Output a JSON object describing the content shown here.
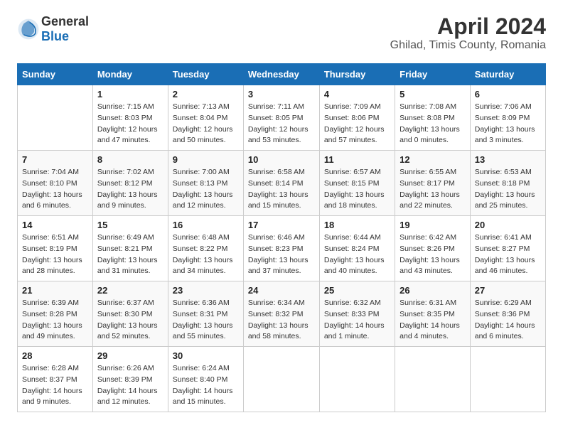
{
  "header": {
    "logo_general": "General",
    "logo_blue": "Blue",
    "month_title": "April 2024",
    "location": "Ghilad, Timis County, Romania"
  },
  "weekdays": [
    "Sunday",
    "Monday",
    "Tuesday",
    "Wednesday",
    "Thursday",
    "Friday",
    "Saturday"
  ],
  "weeks": [
    [
      {
        "day": "",
        "sunrise": "",
        "sunset": "",
        "daylight": ""
      },
      {
        "day": "1",
        "sunrise": "Sunrise: 7:15 AM",
        "sunset": "Sunset: 8:03 PM",
        "daylight": "Daylight: 12 hours and 47 minutes."
      },
      {
        "day": "2",
        "sunrise": "Sunrise: 7:13 AM",
        "sunset": "Sunset: 8:04 PM",
        "daylight": "Daylight: 12 hours and 50 minutes."
      },
      {
        "day": "3",
        "sunrise": "Sunrise: 7:11 AM",
        "sunset": "Sunset: 8:05 PM",
        "daylight": "Daylight: 12 hours and 53 minutes."
      },
      {
        "day": "4",
        "sunrise": "Sunrise: 7:09 AM",
        "sunset": "Sunset: 8:06 PM",
        "daylight": "Daylight: 12 hours and 57 minutes."
      },
      {
        "day": "5",
        "sunrise": "Sunrise: 7:08 AM",
        "sunset": "Sunset: 8:08 PM",
        "daylight": "Daylight: 13 hours and 0 minutes."
      },
      {
        "day": "6",
        "sunrise": "Sunrise: 7:06 AM",
        "sunset": "Sunset: 8:09 PM",
        "daylight": "Daylight: 13 hours and 3 minutes."
      }
    ],
    [
      {
        "day": "7",
        "sunrise": "Sunrise: 7:04 AM",
        "sunset": "Sunset: 8:10 PM",
        "daylight": "Daylight: 13 hours and 6 minutes."
      },
      {
        "day": "8",
        "sunrise": "Sunrise: 7:02 AM",
        "sunset": "Sunset: 8:12 PM",
        "daylight": "Daylight: 13 hours and 9 minutes."
      },
      {
        "day": "9",
        "sunrise": "Sunrise: 7:00 AM",
        "sunset": "Sunset: 8:13 PM",
        "daylight": "Daylight: 13 hours and 12 minutes."
      },
      {
        "day": "10",
        "sunrise": "Sunrise: 6:58 AM",
        "sunset": "Sunset: 8:14 PM",
        "daylight": "Daylight: 13 hours and 15 minutes."
      },
      {
        "day": "11",
        "sunrise": "Sunrise: 6:57 AM",
        "sunset": "Sunset: 8:15 PM",
        "daylight": "Daylight: 13 hours and 18 minutes."
      },
      {
        "day": "12",
        "sunrise": "Sunrise: 6:55 AM",
        "sunset": "Sunset: 8:17 PM",
        "daylight": "Daylight: 13 hours and 22 minutes."
      },
      {
        "day": "13",
        "sunrise": "Sunrise: 6:53 AM",
        "sunset": "Sunset: 8:18 PM",
        "daylight": "Daylight: 13 hours and 25 minutes."
      }
    ],
    [
      {
        "day": "14",
        "sunrise": "Sunrise: 6:51 AM",
        "sunset": "Sunset: 8:19 PM",
        "daylight": "Daylight: 13 hours and 28 minutes."
      },
      {
        "day": "15",
        "sunrise": "Sunrise: 6:49 AM",
        "sunset": "Sunset: 8:21 PM",
        "daylight": "Daylight: 13 hours and 31 minutes."
      },
      {
        "day": "16",
        "sunrise": "Sunrise: 6:48 AM",
        "sunset": "Sunset: 8:22 PM",
        "daylight": "Daylight: 13 hours and 34 minutes."
      },
      {
        "day": "17",
        "sunrise": "Sunrise: 6:46 AM",
        "sunset": "Sunset: 8:23 PM",
        "daylight": "Daylight: 13 hours and 37 minutes."
      },
      {
        "day": "18",
        "sunrise": "Sunrise: 6:44 AM",
        "sunset": "Sunset: 8:24 PM",
        "daylight": "Daylight: 13 hours and 40 minutes."
      },
      {
        "day": "19",
        "sunrise": "Sunrise: 6:42 AM",
        "sunset": "Sunset: 8:26 PM",
        "daylight": "Daylight: 13 hours and 43 minutes."
      },
      {
        "day": "20",
        "sunrise": "Sunrise: 6:41 AM",
        "sunset": "Sunset: 8:27 PM",
        "daylight": "Daylight: 13 hours and 46 minutes."
      }
    ],
    [
      {
        "day": "21",
        "sunrise": "Sunrise: 6:39 AM",
        "sunset": "Sunset: 8:28 PM",
        "daylight": "Daylight: 13 hours and 49 minutes."
      },
      {
        "day": "22",
        "sunrise": "Sunrise: 6:37 AM",
        "sunset": "Sunset: 8:30 PM",
        "daylight": "Daylight: 13 hours and 52 minutes."
      },
      {
        "day": "23",
        "sunrise": "Sunrise: 6:36 AM",
        "sunset": "Sunset: 8:31 PM",
        "daylight": "Daylight: 13 hours and 55 minutes."
      },
      {
        "day": "24",
        "sunrise": "Sunrise: 6:34 AM",
        "sunset": "Sunset: 8:32 PM",
        "daylight": "Daylight: 13 hours and 58 minutes."
      },
      {
        "day": "25",
        "sunrise": "Sunrise: 6:32 AM",
        "sunset": "Sunset: 8:33 PM",
        "daylight": "Daylight: 14 hours and 1 minute."
      },
      {
        "day": "26",
        "sunrise": "Sunrise: 6:31 AM",
        "sunset": "Sunset: 8:35 PM",
        "daylight": "Daylight: 14 hours and 4 minutes."
      },
      {
        "day": "27",
        "sunrise": "Sunrise: 6:29 AM",
        "sunset": "Sunset: 8:36 PM",
        "daylight": "Daylight: 14 hours and 6 minutes."
      }
    ],
    [
      {
        "day": "28",
        "sunrise": "Sunrise: 6:28 AM",
        "sunset": "Sunset: 8:37 PM",
        "daylight": "Daylight: 14 hours and 9 minutes."
      },
      {
        "day": "29",
        "sunrise": "Sunrise: 6:26 AM",
        "sunset": "Sunset: 8:39 PM",
        "daylight": "Daylight: 14 hours and 12 minutes."
      },
      {
        "day": "30",
        "sunrise": "Sunrise: 6:24 AM",
        "sunset": "Sunset: 8:40 PM",
        "daylight": "Daylight: 14 hours and 15 minutes."
      },
      {
        "day": "",
        "sunrise": "",
        "sunset": "",
        "daylight": ""
      },
      {
        "day": "",
        "sunrise": "",
        "sunset": "",
        "daylight": ""
      },
      {
        "day": "",
        "sunrise": "",
        "sunset": "",
        "daylight": ""
      },
      {
        "day": "",
        "sunrise": "",
        "sunset": "",
        "daylight": ""
      }
    ]
  ]
}
